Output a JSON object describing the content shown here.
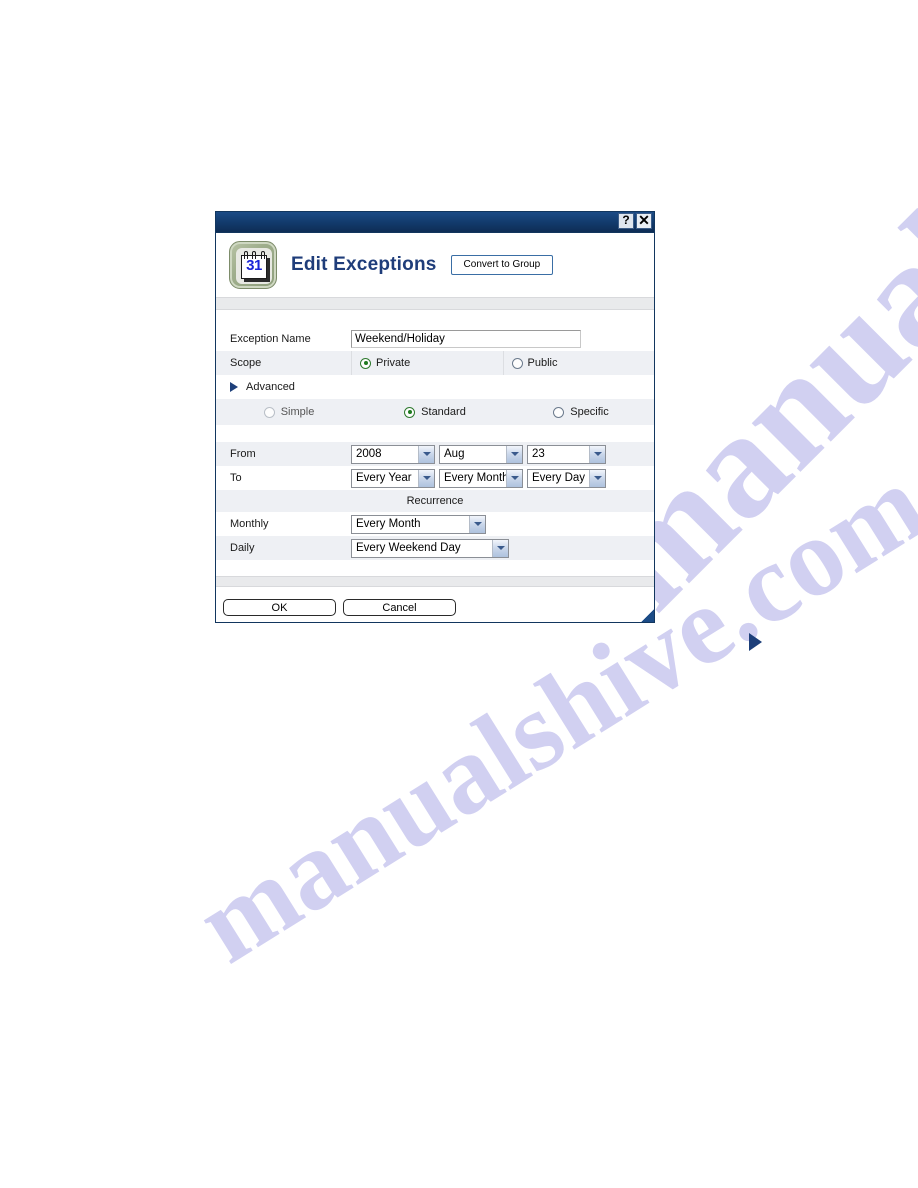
{
  "watermark": {
    "line1": "manualshive.com",
    "line2": "manualshive.com"
  },
  "dialog": {
    "titlebar": {
      "help_label": "?",
      "close_label": "✕"
    },
    "header": {
      "icon_day": "31",
      "title": "Edit Exceptions",
      "convert_button": "Convert to Group"
    },
    "fields": {
      "exception_name_label": "Exception Name",
      "exception_name_value": "Weekend/Holiday",
      "exception_name_placeholder": "Exception Name",
      "scope_label": "Scope",
      "scope_private": "Private",
      "scope_public": "Public",
      "advanced_label": "Advanced"
    },
    "modes": [
      {
        "label": "Simple",
        "selected": false
      },
      {
        "label": "Standard",
        "selected": true
      },
      {
        "label": "Specific",
        "selected": false
      }
    ],
    "dates": {
      "from_label": "From",
      "from_year": "2008",
      "from_month": "Aug",
      "from_day": "23",
      "to_label": "To",
      "to_year": "Every Year",
      "to_month": "Every Month",
      "to_day": "Every Day"
    },
    "recurrence": {
      "header": "Recurrence",
      "monthly_label": "Monthly",
      "monthly_value": "Every Month",
      "daily_label": "Daily",
      "daily_value": "Every Weekend Day"
    },
    "footer": {
      "ok_label": "OK",
      "cancel_label": "Cancel"
    }
  },
  "colors": {
    "titlebar": "#12365e",
    "accent_title_text": "#1f3d7a",
    "radio_on": "#1e7a1e",
    "row_alt": "#eef0f4",
    "watermark": "#c9c8ef"
  }
}
